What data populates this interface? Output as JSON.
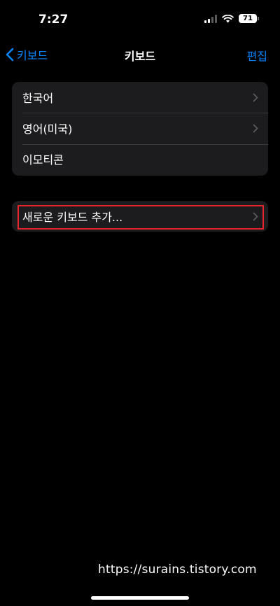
{
  "status_bar": {
    "time": "7:27",
    "battery_level": "71",
    "signal_bars_active": 2,
    "signal_bars_total": 4
  },
  "nav": {
    "back_label": "키보드",
    "title": "키보드",
    "edit_label": "편집"
  },
  "keyboards": [
    {
      "label": "한국어",
      "has_chevron": true
    },
    {
      "label": "영어(미국)",
      "has_chevron": true
    },
    {
      "label": "이모티콘",
      "has_chevron": false
    }
  ],
  "add_keyboard": {
    "label": "새로운 키보드 추가...",
    "highlighted": true,
    "highlight_color": "#e5262d"
  },
  "watermark": "https://surains.tistory.com",
  "colors": {
    "background": "#000000",
    "cell_background": "#1c1c1e",
    "accent": "#0a84ff",
    "chevron": "#5a5a5e"
  }
}
